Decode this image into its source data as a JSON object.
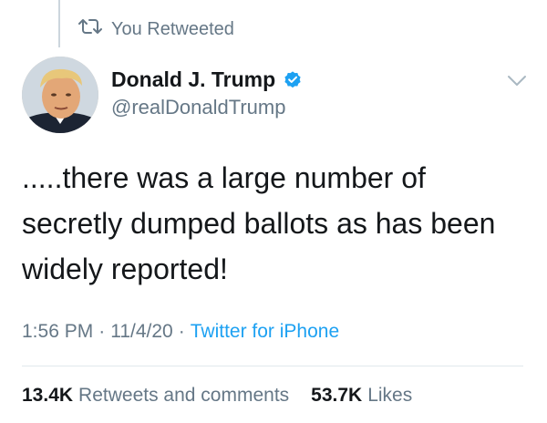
{
  "retweet_context": {
    "label": "You Retweeted"
  },
  "author": {
    "name": "Donald J. Trump",
    "handle": "@realDonaldTrump"
  },
  "tweet": {
    "text": ".....there was a large number of\nsecretly dumped ballots as has been\nwidely reported!"
  },
  "meta": {
    "time": "1:56 PM",
    "date": "11/4/20",
    "source": "Twitter for iPhone",
    "separator": "·"
  },
  "stats": {
    "retweets_count": "13.4K",
    "retweets_label": "Retweets and comments",
    "likes_count": "53.7K",
    "likes_label": "Likes"
  },
  "colors": {
    "accent": "#1da1f2",
    "secondary_text": "#657786",
    "primary_text": "#14171a"
  },
  "icons": {
    "retweet": "retweet-icon",
    "verified": "verified-badge-icon",
    "caret": "chevron-down-icon"
  }
}
